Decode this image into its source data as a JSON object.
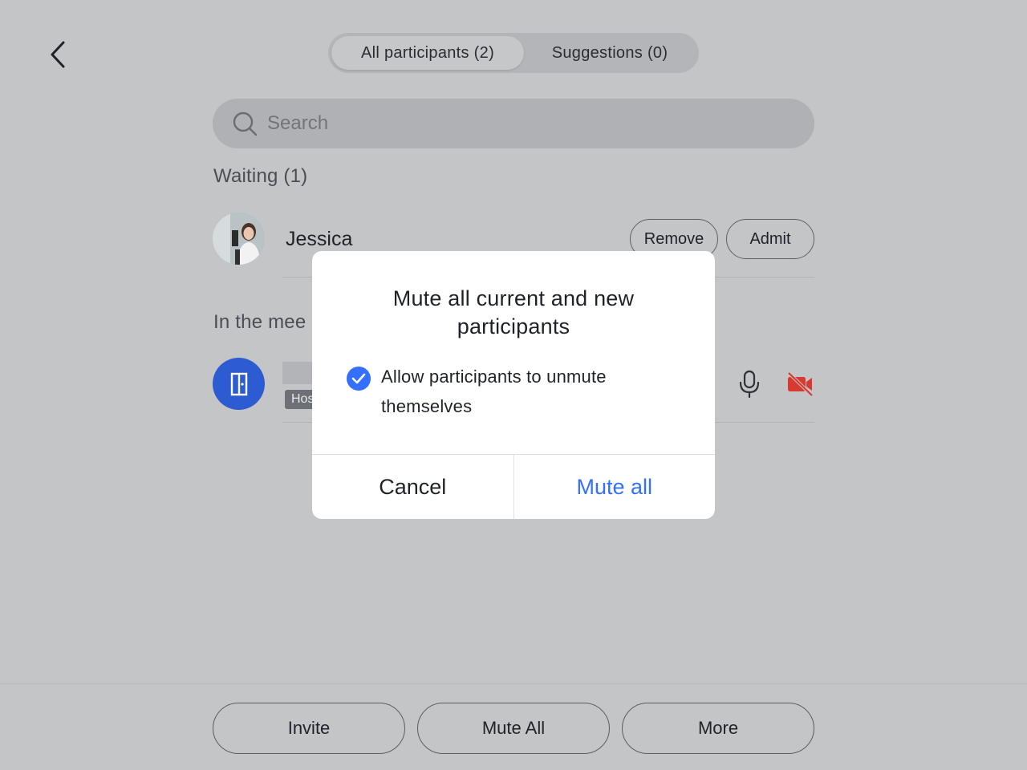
{
  "tabs": [
    {
      "label": "All participants (2)",
      "active": true
    },
    {
      "label": "Suggestions (0)",
      "active": false
    }
  ],
  "search": {
    "placeholder": "Search",
    "value": ""
  },
  "waiting": {
    "section_label": "Waiting (1)",
    "participants": [
      {
        "name": "Jessica",
        "remove_label": "Remove",
        "admit_label": "Admit"
      }
    ]
  },
  "in_meeting": {
    "section_label": "In the mee",
    "participants": [
      {
        "name": "",
        "badge": "Host",
        "mic": "mic-on",
        "camera": "camera-off"
      }
    ]
  },
  "footer": {
    "invite_label": "Invite",
    "mute_all_label": "Mute All",
    "more_label": "More"
  },
  "dialog": {
    "title": "Mute all current and new participants",
    "option_label": "Allow participants to unmute themselves",
    "option_checked": true,
    "cancel_label": "Cancel",
    "confirm_label": "Mute all"
  },
  "colors": {
    "overlay_bg": "#c4c5c7",
    "accent": "#3370ff",
    "room_avatar": "#2d5bd1",
    "camera_off": "#d83931"
  }
}
